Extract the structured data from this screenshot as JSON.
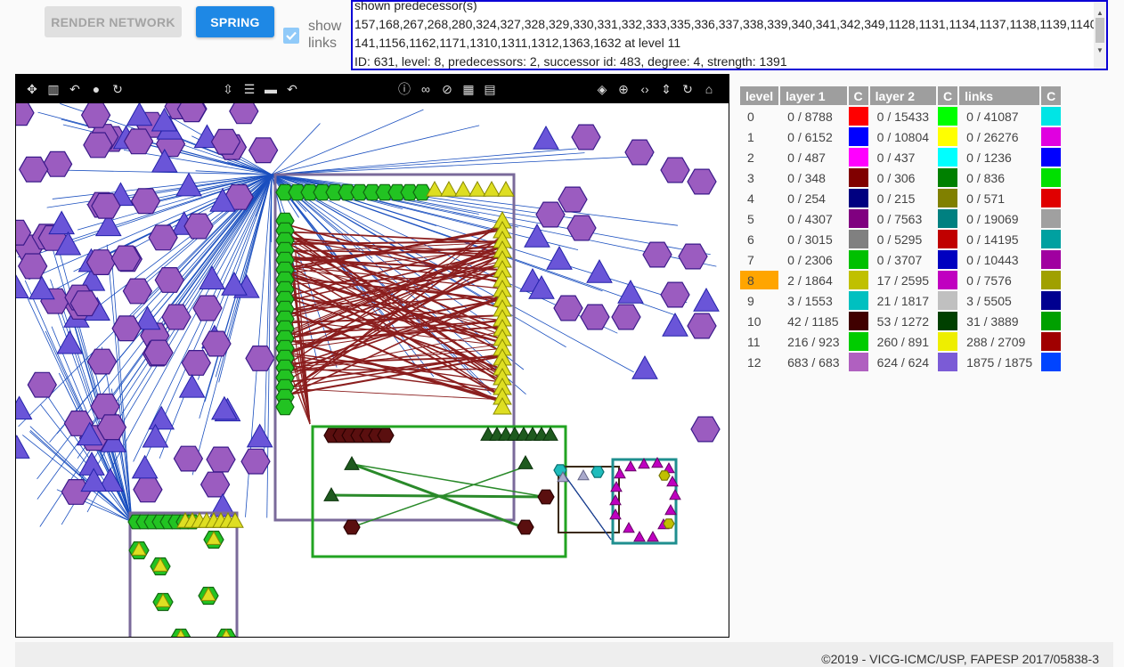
{
  "buttons": {
    "render_label": "RENDER NETWORK",
    "spring_label": "SPRING"
  },
  "show_links": {
    "label": "show links",
    "checked": true
  },
  "info": {
    "line1": "shown predecessor(s)",
    "line2": "157,168,267,268,280,324,327,328,329,330,331,332,333,335,336,337,338,339,340,341,342,349,1128,1131,1134,1137,1138,1139,1140,1",
    "line3": "141,1156,1162,1171,1310,1311,1312,1363,1632 at level 11",
    "line4": "ID: 631, level: 8, predecessors: 2, successor id: 483, degree: 4, strength: 1391"
  },
  "toolbar_icons": [
    "move-icon",
    "bar-chart-icon",
    "undo-icon",
    "toggle-icon",
    "rotate-icon",
    "compress-vertical-icon",
    "lines-icon",
    "panel-icon",
    "undo-icon-2",
    "info-icon",
    "link-icon",
    "compass-icon",
    "grid-icon",
    "film-icon",
    "paint-bucket-icon",
    "zoom-icon",
    "code-icon",
    "expand-vertical-icon",
    "refresh-icon",
    "home-icon"
  ],
  "legend": {
    "headers": [
      "level",
      "layer 1",
      "C",
      "layer 2",
      "C",
      "links",
      "C"
    ],
    "highlight_level": "8",
    "rows": [
      {
        "level": "0",
        "l1": "0 / 8788",
        "c1": "#ff0000",
        "l2": "0 / 15433",
        "c2": "#00ff00",
        "links": "0 / 41087",
        "c3": "#00e5e5"
      },
      {
        "level": "1",
        "l1": "0 / 6152",
        "c1": "#0000ff",
        "l2": "0 / 10804",
        "c2": "#ffff00",
        "links": "0 / 26276",
        "c3": "#e000e0"
      },
      {
        "level": "2",
        "l1": "0 / 487",
        "c1": "#ff00ff",
        "l2": "0 / 437",
        "c2": "#00ffff",
        "links": "0 / 1236",
        "c3": "#0000ff"
      },
      {
        "level": "3",
        "l1": "0 / 348",
        "c1": "#800000",
        "l2": "0 / 306",
        "c2": "#008000",
        "links": "0 / 836",
        "c3": "#00e000"
      },
      {
        "level": "4",
        "l1": "0 / 254",
        "c1": "#000080",
        "l2": "0 / 215",
        "c2": "#808000",
        "links": "0 / 571",
        "c3": "#e00000"
      },
      {
        "level": "5",
        "l1": "0 / 4307",
        "c1": "#800080",
        "l2": "0 / 7563",
        "c2": "#008080",
        "links": "0 / 19069",
        "c3": "#a0a0a0"
      },
      {
        "level": "6",
        "l1": "0 / 3015",
        "c1": "#808080",
        "l2": "0 / 5295",
        "c2": "#c00000",
        "links": "0 / 14195",
        "c3": "#00a0a0"
      },
      {
        "level": "7",
        "l1": "0 / 2306",
        "c1": "#00c000",
        "l2": "0 / 3707",
        "c2": "#0000c0",
        "links": "0 / 10443",
        "c3": "#a000a0"
      },
      {
        "level": "8",
        "l1": "2 / 1864",
        "c1": "#c0c000",
        "l2": "17 / 2595",
        "c2": "#c000c0",
        "links": "0 / 7576",
        "c3": "#a0a000"
      },
      {
        "level": "9",
        "l1": "3 / 1553",
        "c1": "#00c0c0",
        "l2": "21 / 1817",
        "c2": "#c0c0c0",
        "links": "3 / 5505",
        "c3": "#000090"
      },
      {
        "level": "10",
        "l1": "42 / 1185",
        "c1": "#400000",
        "l2": "53 / 1272",
        "c2": "#004000",
        "links": "31 / 3889",
        "c3": "#00a000"
      },
      {
        "level": "11",
        "l1": "216 / 923",
        "c1": "#00cc00",
        "l2": "260 / 891",
        "c2": "#eeee00",
        "links": "288 / 2709",
        "c3": "#a00000"
      },
      {
        "level": "12",
        "l1": "683 / 683",
        "c1": "#b060c0",
        "l2": "624 / 624",
        "c2": "#7b5bd6",
        "links": "1875 / 1875",
        "c3": "#0044ff"
      }
    ]
  },
  "footer": {
    "text": "©2019 - VICG-ICMC/USP, FAPESP 2017/05838-3"
  }
}
